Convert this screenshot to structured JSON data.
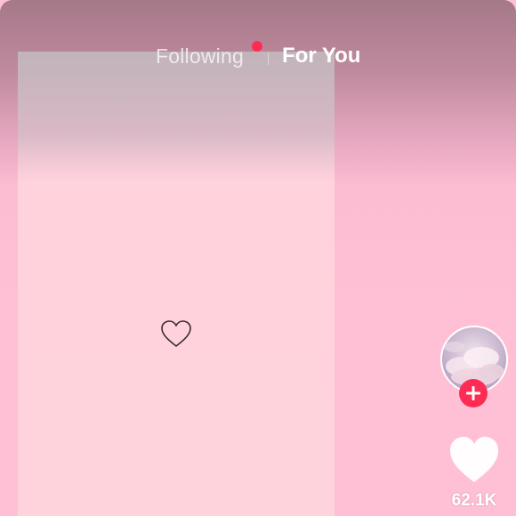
{
  "nav": {
    "following_label": "Following",
    "foryou_label": "For You",
    "active_tab": "For You",
    "has_following_notification": true
  },
  "colors": {
    "accent": "#fe2c55",
    "background": "#ffc0d5",
    "panel": "#ffd3dc"
  },
  "icons": {
    "center": "heart-outline-icon",
    "like": "heart-icon",
    "follow": "plus-icon"
  },
  "actions": {
    "like_count": "62.1K"
  }
}
